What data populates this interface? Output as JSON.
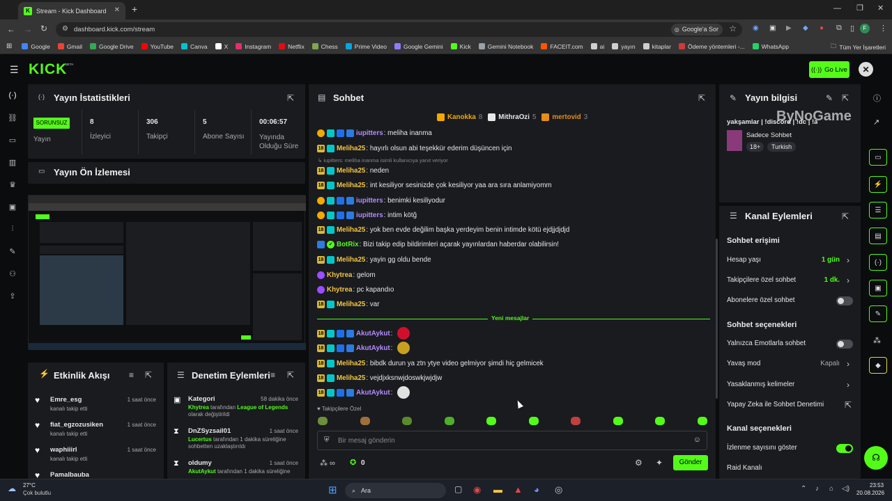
{
  "browser": {
    "tab_title": "Stream - Kick Dashboard",
    "url": "dashboard.kick.com/stream",
    "google_prompt": "Google'a Sor",
    "bookmarks": [
      "Google",
      "Gmail",
      "Google Drive",
      "YouTube",
      "Canva",
      "X",
      "Instagram",
      "Netflix",
      "Chess",
      "Prime Video",
      "Google Gemini",
      "Kick",
      "Gemini Notebook",
      "FACEIT.com",
      "ai",
      "yayın",
      "kitaplar",
      "Ödeme yöntemleri -...",
      "WhatsApp"
    ],
    "all_bookmarks": "Tüm Yer İşaretleri",
    "profile_initial": "F"
  },
  "header": {
    "logo": "KICK",
    "beta": "BETA",
    "go_live": "Go Live"
  },
  "stats": {
    "title": "Yayın İstatistikleri",
    "status_badge": "SORUNSUZ",
    "status_label": "Yayın",
    "viewers": "8",
    "viewers_label": "İzleyici",
    "followers": "306",
    "followers_label": "Takipçi",
    "subs": "5",
    "subs_label": "Abone Sayısı",
    "duration": "00:06:57",
    "duration_label": "Yayında Olduğu Süre"
  },
  "preview": {
    "title": "Yayın Ön İzlemesi"
  },
  "activity": {
    "title": "Etkinlik Akışı",
    "items": [
      {
        "user": "Emre_esg",
        "text": "kanalı takip etti",
        "time": "1 saat önce"
      },
      {
        "user": "fiat_egzozusiken",
        "text": "kanalı takip etti",
        "time": "1 saat önce"
      },
      {
        "user": "waphiiirl",
        "text": "kanalı takip etti",
        "time": "1 saat önce"
      },
      {
        "user": "Pamalbauba",
        "text": "",
        "time": ""
      }
    ]
  },
  "moderation": {
    "title": "Denetim Eylemleri",
    "items": [
      {
        "head": "Kategori",
        "time": "58 dakika önce",
        "actor": "Khytrea",
        "mid": " tarafından ",
        "target": "League of Legends",
        "tail": " olarak değiştirildi"
      },
      {
        "head": "DnZSyzsail01",
        "time": "1 saat önce",
        "actor": "Lucertus",
        "mid": " tarafından 1 dakika süreliğine sohbetten uzaklaştırıldı",
        "target": "",
        "tail": ""
      },
      {
        "head": "oldumy",
        "time": "1 saat önce",
        "actor": "AkutAykut",
        "mid": " tarafından 1 dakika süreliğine",
        "target": "",
        "tail": ""
      }
    ]
  },
  "chat": {
    "title": "Sohbet",
    "top_gifters": [
      {
        "name": "Kanokka",
        "count": "8",
        "color": "#f2a900"
      },
      {
        "name": "MithraOzi",
        "count": "5",
        "color": "#e8e8e8"
      },
      {
        "name": "mertovid",
        "count": "3",
        "color": "#e58c1a"
      }
    ],
    "messages": [
      {
        "badges": [
          "b1",
          "b3",
          "b4",
          "b5"
        ],
        "user": "iupitters",
        "color": "#b58cff",
        "text": "meliha inanma"
      },
      {
        "badges": [
          "b2",
          "b3"
        ],
        "user": "Meliha25",
        "color": "#f5c542",
        "text": "hayırlı olsun abi teşekkür ederim düşüncen için"
      },
      {
        "reply": "iupitters: meliha inanma isimli kullanıcıya yanıt veriyor"
      },
      {
        "badges": [
          "b2",
          "b3"
        ],
        "user": "Meliha25",
        "color": "#f5c542",
        "text": "neden"
      },
      {
        "badges": [
          "b2",
          "b3"
        ],
        "user": "Meliha25",
        "color": "#f5c542",
        "text": "int kesiliyor sesinizde çok kesiliyor yaa ara sıra anlamiyomm"
      },
      {
        "badges": [
          "b1",
          "b3",
          "b4",
          "b5"
        ],
        "user": "iupitters",
        "color": "#b58cff",
        "text": "benimki kesiliyodur"
      },
      {
        "badges": [
          "b1",
          "b3",
          "b4",
          "b5"
        ],
        "user": "iupitters",
        "color": "#b58cff",
        "text": "intim kötğ"
      },
      {
        "badges": [
          "b2",
          "b3"
        ],
        "user": "Meliha25",
        "color": "#f5c542",
        "text": "yok ben evde değilim başka yerdeyim benin intimde kötü ejdjjdjdjd"
      },
      {
        "badges": [
          "b5",
          "b7"
        ],
        "user": "BotRix",
        "color": "#53fc18",
        "text": "Bizi takip edip bildirimleri açarak yayınlardan haberdar olabilirsin!"
      },
      {
        "badges": [
          "b2",
          "b3"
        ],
        "user": "Meliha25",
        "color": "#f5c542",
        "text": "yayin gg oldu bende"
      },
      {
        "badges": [
          "b6"
        ],
        "user": "Khytrea",
        "color": "#f5c542",
        "text": "gelom"
      },
      {
        "badges": [
          "b6"
        ],
        "user": "Khytrea",
        "color": "#f5c542",
        "text": "pc kapandıo"
      },
      {
        "badges": [
          "b2",
          "b3"
        ],
        "user": "Meliha25",
        "color": "#f5c542",
        "text": "var"
      },
      {
        "divider": "Yeni mesajlar"
      },
      {
        "badges": [
          "b2",
          "b3",
          "b4",
          "b5"
        ],
        "user": "AkutAykut",
        "color": "#b58cff",
        "text": "",
        "emote": "#d0102a"
      },
      {
        "badges": [
          "b2",
          "b3",
          "b4",
          "b5"
        ],
        "user": "AkutAykut",
        "color": "#b58cff",
        "text": "",
        "emote": "#c8a020"
      },
      {
        "badges": [
          "b2",
          "b3"
        ],
        "user": "Meliha25",
        "color": "#f5c542",
        "text": "bibdk durun ya ztn ytye video gelmiyor şimdi hiç gelmicek"
      },
      {
        "badges": [
          "b2",
          "b3"
        ],
        "user": "Meliha25",
        "color": "#f5c542",
        "text": "vejdjxksnwjdoswkjwjdjw"
      },
      {
        "badges": [
          "b2",
          "b3",
          "b4",
          "b5"
        ],
        "user": "AkutAykut",
        "color": "#b58cff",
        "text": "",
        "emote": "#e0e0e0"
      }
    ],
    "followers_only_label": "Takipçilere Özel",
    "emote_colors": [
      "#6b8f3a",
      "#a0703a",
      "#5a8a2a",
      "#4fae2a",
      "#53fc18",
      "#53fc18",
      "#c04040",
      "#53fc18",
      "#53fc18",
      "#53fc18"
    ],
    "input_placeholder": "Bir mesaj gönderin",
    "points": "0",
    "send": "Gönder"
  },
  "stream_info": {
    "title": "Yayın bilgisi",
    "stream_title": "yakşamlar | !discord | !dc | !a",
    "category": "Sadece Sohbet",
    "tags": [
      "18+",
      "Turkish"
    ],
    "watermark": "ByNoGame"
  },
  "channel_actions": {
    "title": "Kanal Eylemleri",
    "chat_access": "Sohbet erişimi",
    "account_age": "Hesap yaşı",
    "account_age_val": "1 gün",
    "followers_only": "Takipçilere özel sohbet",
    "followers_only_val": "1 dk.",
    "subs_only": "Abonelere özel sohbet",
    "chat_options": "Sohbet seçenekleri",
    "emote_only": "Yalnızca Emotlarla sohbet",
    "slow_mode": "Yavaş mod",
    "slow_mode_val": "Kapalı",
    "banned_words": "Yasaklanmış kelimeler",
    "ai_moderation": "Yapay Zeka ile Sohbet Denetimi",
    "channel_options": "Kanal seçenekleri",
    "show_viewers": "İzlenme sayısını göster",
    "raid": "Raid Kanalı"
  },
  "taskbar": {
    "temp": "27°C",
    "weather": "Çok bulutlu",
    "search": "Ara",
    "time": "23:53",
    "date": "20.08.2026"
  }
}
